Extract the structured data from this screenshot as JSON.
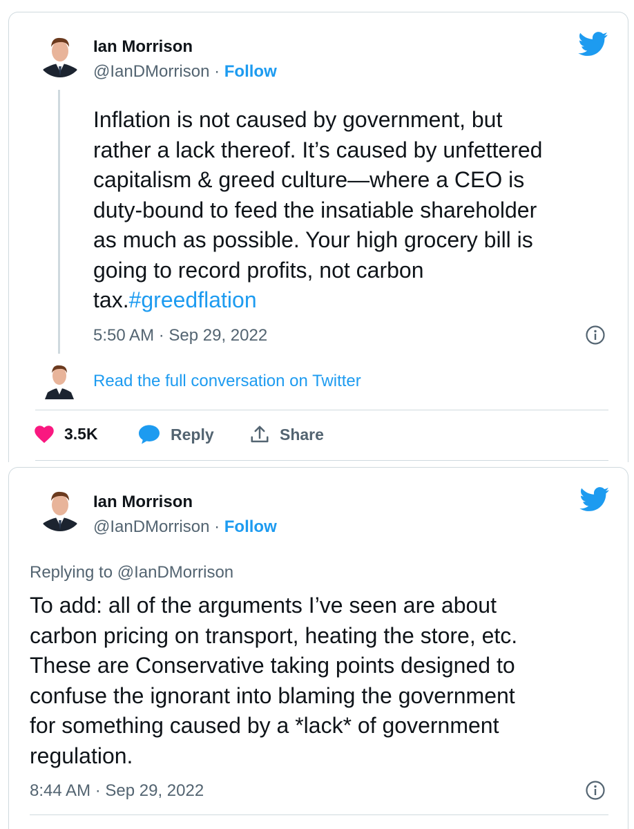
{
  "tweet1": {
    "author_name": "Ian Morrison",
    "handle": "@IanDMorrison",
    "dot": " · ",
    "follow_label": "Follow",
    "text_main": "Inflation is not caused by government, but\nrather a lack thereof. It’s caused by unfettered\ncapitalism & greed culture—where a CEO is\nduty-bound to feed the insatiable shareholder\nas much as possible. Your high grocery bill is\ngoing to record profits, not carbon\ntax.",
    "hashtag": "#greedflation",
    "timestamp": "5:50 AM · Sep 29, 2022",
    "read_more": "Read the full conversation on Twitter",
    "likes": "3.5K",
    "reply_label": "Reply",
    "share_label": "Share"
  },
  "tweet2": {
    "author_name": "Ian Morrison",
    "handle": "@IanDMorrison",
    "dot": " · ",
    "follow_label": "Follow",
    "replying_to": "Replying to @IanDMorrison",
    "text": "To add: all of the arguments I’ve seen are about\ncarbon pricing on transport, heating the store, etc.\nThese are Conservative taking points designed to\nconfuse the ignorant into blaming the government\nfor something caused by a *lack* of government\nregulation.",
    "timestamp": "8:44 AM · Sep 29, 2022"
  },
  "colors": {
    "accent": "#1d9bf0",
    "like": "#f91880",
    "muted": "#536471",
    "border": "#cfd9de"
  },
  "icons": [
    "twitter-bird-icon",
    "info-icon",
    "heart-icon",
    "reply-bubble-icon",
    "share-icon"
  ]
}
